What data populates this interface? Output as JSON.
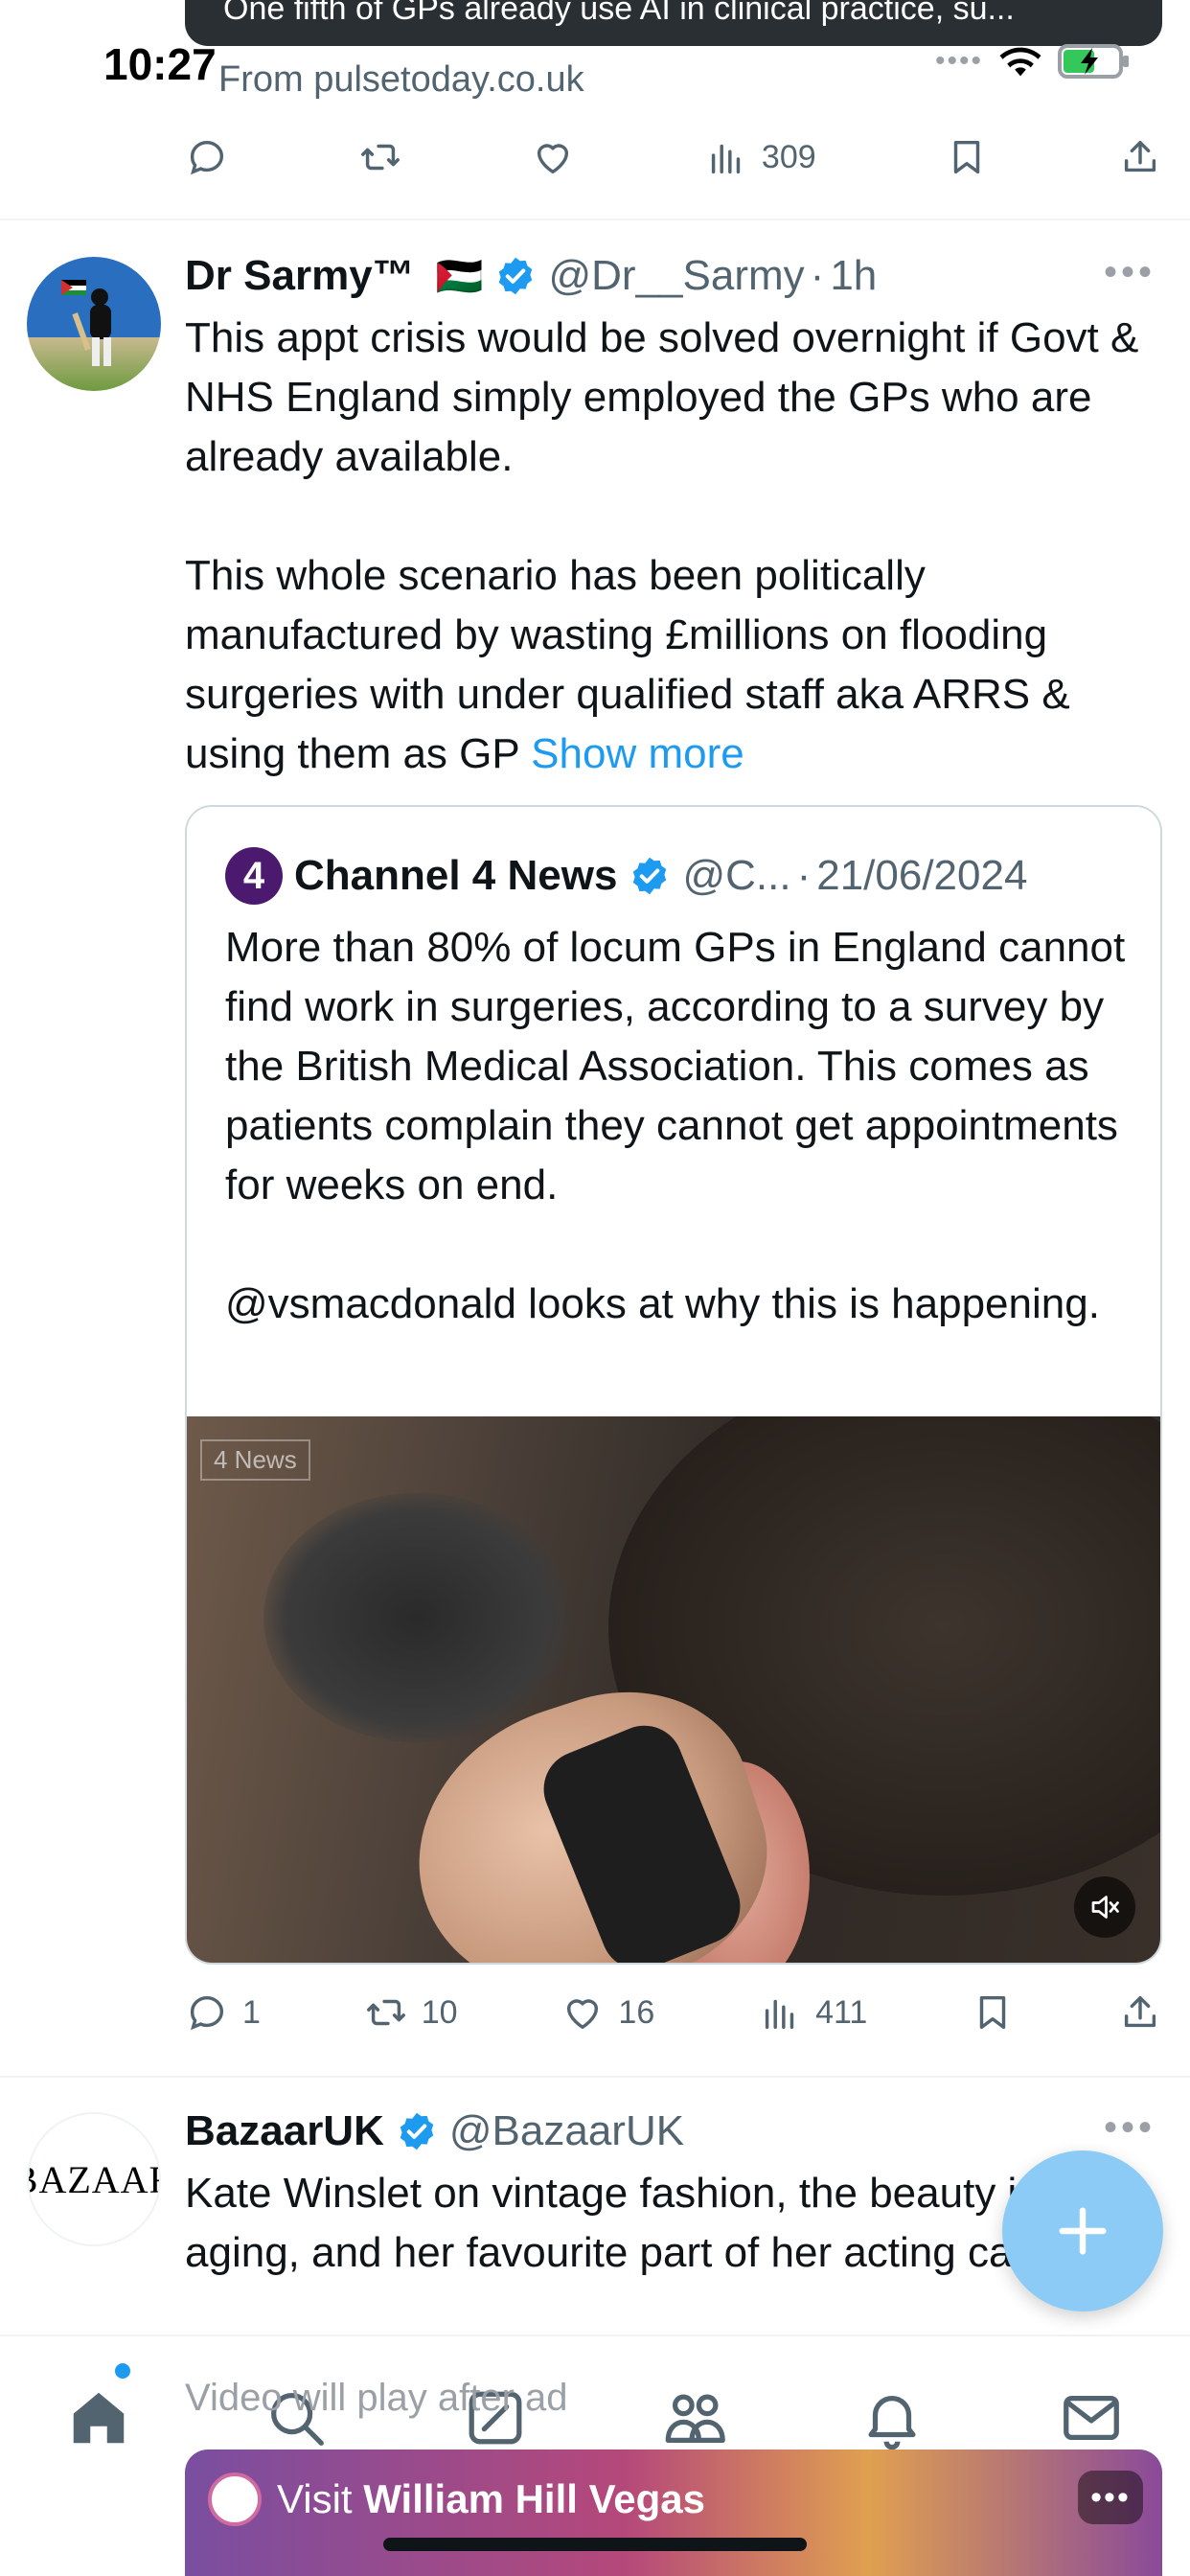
{
  "status_bar": {
    "time": "10:27"
  },
  "prev_tweet": {
    "card_caption": "One fifth of GPs already use AI in clinical practice, su...",
    "source": "From pulsetoday.co.uk",
    "views": "309"
  },
  "tweet1": {
    "display_name": "Dr Sarmy™",
    "flag": "🇵🇸",
    "handle": "@Dr__Sarmy",
    "separator": "·",
    "time": "1h",
    "text_p1": "This appt crisis would be solved overnight if Govt & NHS England simply employed the GPs who are already available.",
    "text_p2": "This whole scenario has been politically manufactured by wasting £millions on flooding surgeries with under qualified staff aka ARRS & using them as GP ",
    "show_more": "Show more",
    "quote": {
      "avatar_letter": "4",
      "display_name": "Channel 4 News",
      "handle": "@C...",
      "separator": "·",
      "date": "21/06/2024",
      "text_p1": "More than 80% of locum GPs in England cannot find work in surgeries, according to a survey by the British Medical Association. This comes as patients complain they cannot get appointments for weeks on end.",
      "text_p2": "@vsmacdonald  looks at why this is happening.",
      "video_watermark": "4 News"
    },
    "replies": "1",
    "retweets": "10",
    "likes": "16",
    "views": "411"
  },
  "tweet2": {
    "avatar_text": "BAZAAR",
    "display_name": "BazaarUK",
    "handle": "@BazaarUK",
    "text": "Kate Winslet on vintage fashion, the beauty in aging, and her favourite part of her acting career"
  },
  "ad": {
    "label": "Video will play after ad",
    "visit_prefix": "Visit ",
    "advertiser": "William Hill Vegas"
  },
  "colors": {
    "accent": "#1d9bf0",
    "muted": "#536471",
    "fab": "#8ccbf5"
  }
}
